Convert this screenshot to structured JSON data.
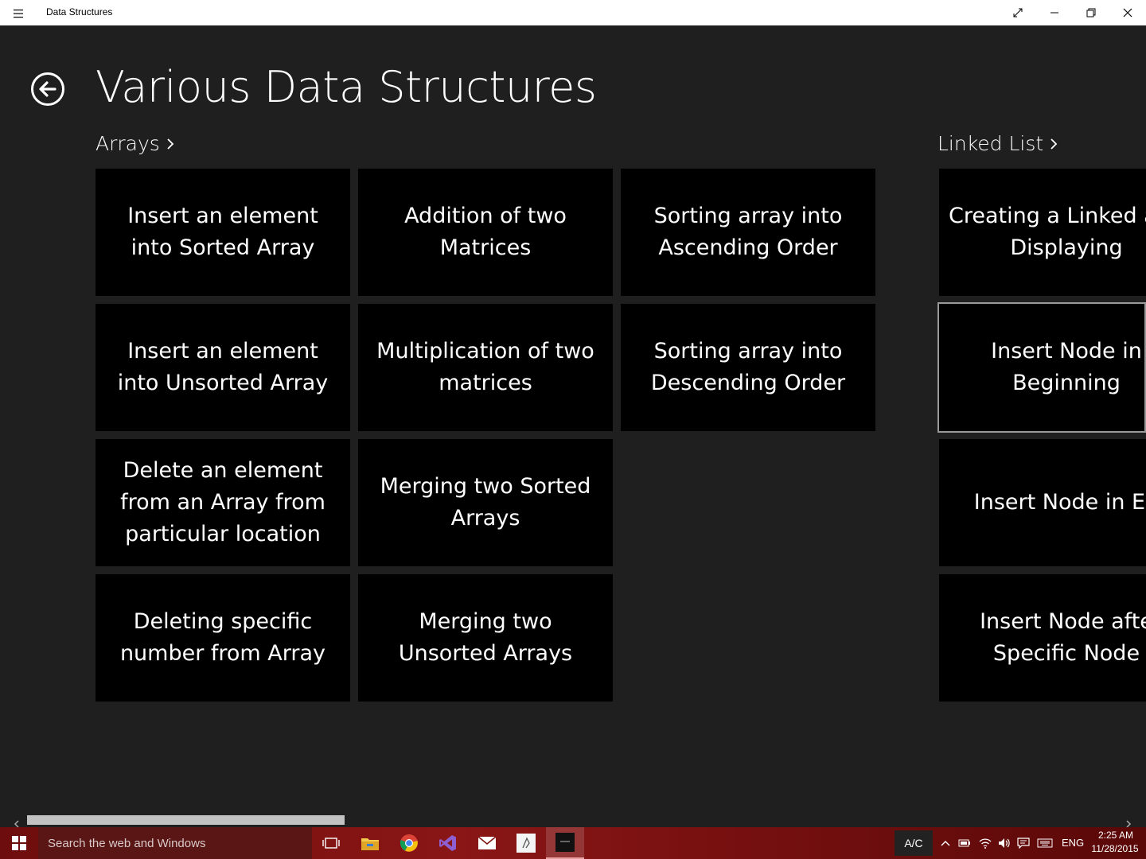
{
  "window": {
    "title": "Data Structures",
    "menu_icon": "hamburger-icon",
    "controls": [
      "fullscreen-icon",
      "minimize-icon",
      "restore-icon",
      "close-icon"
    ]
  },
  "page": {
    "title": "Various Data Structures",
    "back_icon": "back-arrow-icon"
  },
  "sections": [
    {
      "header": "Arrays",
      "tiles": [
        "Insert an element into Sorted Array",
        "Addition of two Matrices",
        "Sorting array into Ascending Order",
        "Insert an element into Unsorted Array",
        "Multiplication of two matrices",
        "Sorting array into Descending Order",
        "Delete an element from an Array from particular location",
        "Merging two Sorted Arrays",
        "Deleting specific number from Array",
        "Merging two Unsorted Arrays"
      ]
    },
    {
      "header": "Linked List",
      "tiles": [
        "Creating a Linked and Displaying",
        "Insert Node in Beginning",
        "Insert Node in En",
        "Insert Node afte Specific Node"
      ]
    }
  ],
  "scrollbar": {
    "position_fraction": 0.28
  },
  "taskbar": {
    "search_placeholder": "Search the web and Windows",
    "pinned": [
      "task-view-icon",
      "file-explorer-icon",
      "chrome-icon",
      "visual-studio-icon",
      "mail-icon",
      "app-icon",
      "data-structures-app-icon"
    ],
    "ac_label": "A/C",
    "language": "ENG",
    "time": "2:25 AM",
    "date": "11/28/2015",
    "accent_color": "#7d1010"
  }
}
